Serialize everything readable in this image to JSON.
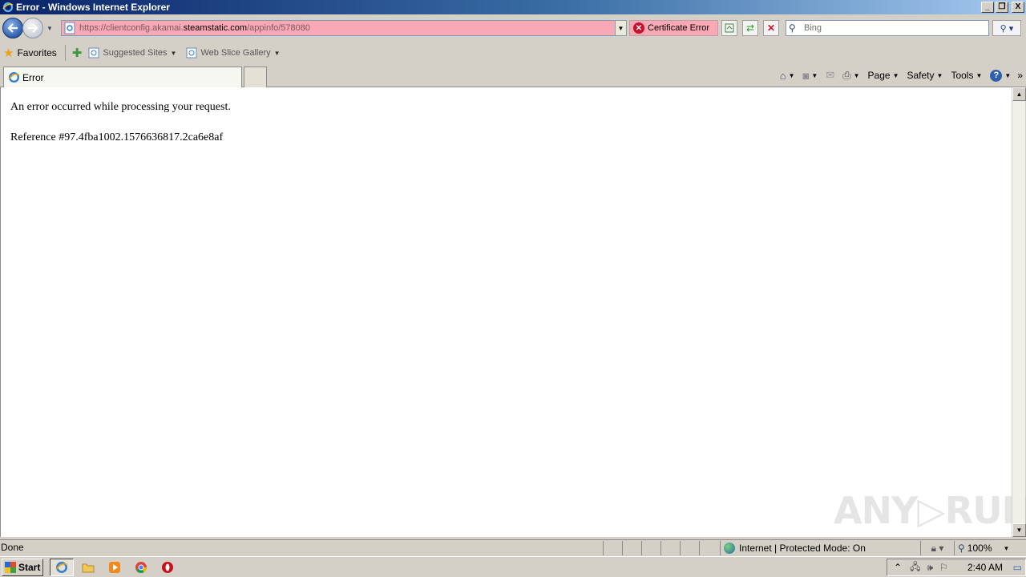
{
  "window": {
    "title": "Error - Windows Internet Explorer",
    "minimize": "_",
    "maximize": "❐",
    "close": "X"
  },
  "navigation": {
    "url_prefix": "https://clientconfig.akamai.",
    "url_domain": "steamstatic.com",
    "url_path": "/appinfo/578080",
    "cert_error": "Certificate Error",
    "search_placeholder": "Bing"
  },
  "favorites_bar": {
    "favorites_label": "Favorites",
    "items": [
      "Suggested Sites",
      "Web Slice Gallery"
    ]
  },
  "tabs": {
    "active_tab_label": "Error"
  },
  "command_bar": {
    "page": "Page",
    "safety": "Safety",
    "tools": "Tools",
    "chevron": "»"
  },
  "page": {
    "message": "An error occurred while processing your request.",
    "reference": "Reference #97.4fba1002.1576636817.2ca6e8af"
  },
  "watermark": "ANY▷RUN",
  "status_bar": {
    "status": "Done",
    "zone": "Internet | Protected Mode: On",
    "zoom": "100%"
  },
  "taskbar": {
    "start_label": "Start",
    "clock": "2:40 AM"
  }
}
